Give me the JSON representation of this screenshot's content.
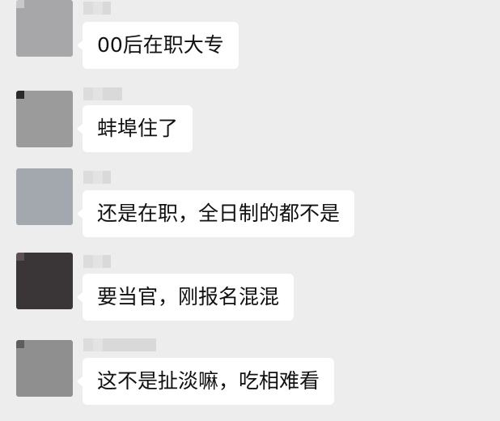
{
  "chat": {
    "messages": [
      {
        "text": "00后在职大专",
        "avatar_tone": [
          "#a7a7a9",
          "#8f9094",
          "#c8c8ca",
          "#7c7d80"
        ]
      },
      {
        "text": "蚌埠住了",
        "avatar_tone": [
          "#9b9b9b",
          "#5b5b5b",
          "#c6c6c6",
          "#2a2a2a"
        ]
      },
      {
        "text": "还是在职，全日制的都不是",
        "avatar_tone": [
          "#a3a7ae",
          "#8a8f96",
          "#bfc3c9",
          "#7a7e84"
        ]
      },
      {
        "text": "要当官，刚报名混混",
        "avatar_tone": [
          "#3a3638",
          "#5b5052",
          "#221e20",
          "#6b5e5f"
        ]
      },
      {
        "text": "这不是扯淡嘛，吃相难看",
        "avatar_tone": [
          "#8f8f8f",
          "#c4c4c4",
          "#5e5e5e",
          "#2f2f2f"
        ]
      }
    ]
  }
}
